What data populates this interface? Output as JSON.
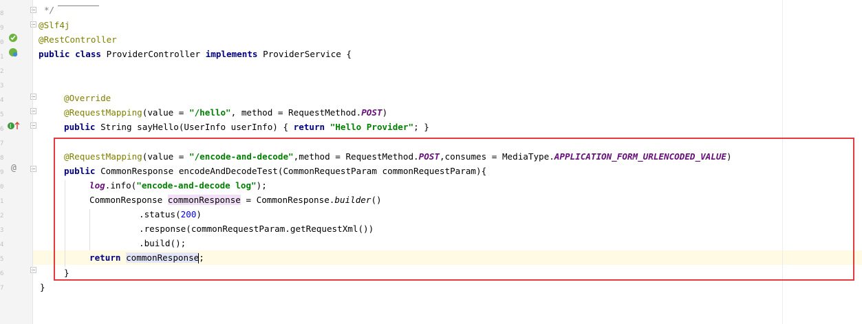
{
  "gutter": {
    "line_numbers": [
      "",
      "",
      "",
      "",
      "",
      "",
      "",
      "",
      "",
      "",
      "",
      "",
      "",
      "",
      "",
      "",
      "",
      "",
      "",
      "",
      "",
      ""
    ]
  },
  "code": {
    "l0_cmt": "*/",
    "l1_ann": "@Slf4j",
    "l2_ann": "@RestController",
    "l3_kw1": "public",
    "l3_kw2": "class",
    "l3_name": "ProviderController",
    "l3_kw3": "implements",
    "l3_iface": "ProviderService {",
    "l6_ann": "@Override",
    "l7_ann": "@RequestMapping",
    "l7_a": "(value = ",
    "l7_str": "\"/hello\"",
    "l7_b": ", method = RequestMethod.",
    "l7_const": "POST",
    "l7_c": ")",
    "l8_kw1": "public",
    "l8_a": "String sayHello(UserInfo userInfo) { ",
    "l8_kw2": "return",
    "l8_str": "\"Hello Provider\"",
    "l8_b": "; }",
    "l10_ann": "@RequestMapping",
    "l10_a": "(value = ",
    "l10_str": "\"/encode-and-decode\"",
    "l10_b": ",method = RequestMethod.",
    "l10_const1": "POST",
    "l10_c": ",consumes = MediaType.",
    "l10_const2": "APPLICATION_FORM_URLENCODED_VALUE",
    "l10_d": ")",
    "l11_kw": "public",
    "l11_a": "CommonResponse encodeAndDecodeTest(CommonRequestParam commonRequestParam){",
    "l12_field": "log",
    "l12_a": ".info(",
    "l12_str": "\"encode-and-decode log\"",
    "l12_b": ");",
    "l13_a": "CommonResponse ",
    "l13_var": "commonResponse",
    "l13_b": " = CommonResponse.",
    "l13_ital": "builder",
    "l13_c": "()",
    "l14_a": ".status(",
    "l14_num": "200",
    "l14_b": ")",
    "l15_a": ".response(commonRequestParam.getRequestXml())",
    "l16_a": ".build();",
    "l17_kw": "return",
    "l17_var": "commonResponse",
    "l17_b": ";",
    "l18_a": "}",
    "l19_a": "}"
  },
  "colors": {
    "keyword": "#000080",
    "annotation": "#808000",
    "string": "#008000",
    "number": "#0000ff",
    "constant": "#660e7a",
    "highlight_box": "#e5393c"
  }
}
